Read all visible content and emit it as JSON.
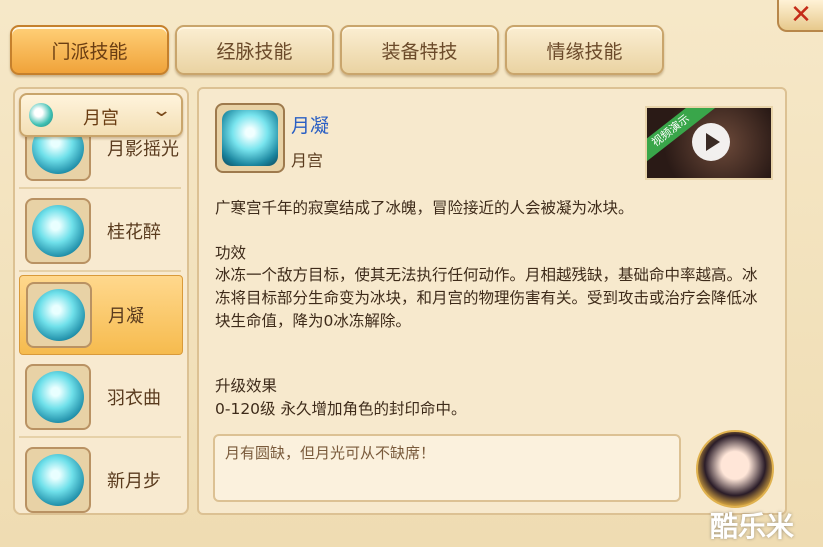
{
  "tabs": [
    {
      "label": "门派技能",
      "active": true
    },
    {
      "label": "经脉技能",
      "active": false
    },
    {
      "label": "装备特技",
      "active": false
    },
    {
      "label": "情缘技能",
      "active": false
    }
  ],
  "school_selector": {
    "value": "月宫",
    "icon": "moon-palace-emblem-icon",
    "caret_icon": "chevron-down-icon"
  },
  "skill_list": [
    {
      "name": "月影摇光",
      "icon": "moon-shadow-skill-icon",
      "selected": false
    },
    {
      "name": "桂花醉",
      "icon": "osmanthus-skill-icon",
      "selected": false
    },
    {
      "name": "月凝",
      "icon": "ice-crystal-skill-icon",
      "selected": true
    },
    {
      "name": "羽衣曲",
      "icon": "crescent-skill-icon",
      "selected": false
    },
    {
      "name": "新月步",
      "icon": "snowflake-skill-icon",
      "selected": false
    }
  ],
  "detail": {
    "title": "月凝",
    "school": "月宫",
    "icon": "ice-crystal-skill-icon",
    "video_badge": "视频演示",
    "description": "广寒宫千年的寂寞结成了冰魄，冒险接近的人会被凝为冰块。",
    "effect_title": "功效",
    "effect_body": "冰冻一个敌方目标，使其无法执行任何动作。月相越残缺，基础命中率越高。冰冻将目标部分生命变为冰块，和月宫的物理伤害有关。受到攻击或治疗会降低冰块生命值，降为0冰冻解除。",
    "upgrade_title": "升级效果",
    "upgrade_body": "0-120级 永久增加角色的封印命中。",
    "quote": "月有圆缺，但月光可从不缺席！"
  },
  "close_icon": "close-icon",
  "watermark": "酷乐米",
  "colors": {
    "accent": "#f0a33a",
    "title_blue": "#2a5fc4",
    "panel": "#f7e9cd"
  }
}
